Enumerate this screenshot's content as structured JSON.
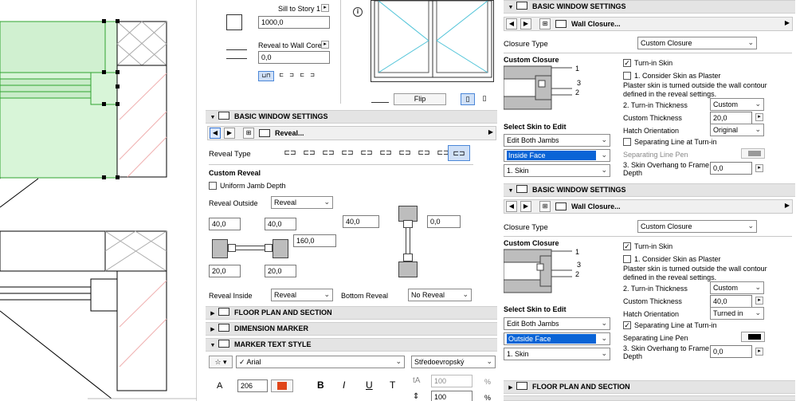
{
  "colors": {
    "accent": "#0a64d6",
    "plan_fill": "#d8f5d8",
    "plan_stroke": "#2fa32f",
    "hatch_red": "#f0b0b0",
    "swatch_red": "#e0461a"
  },
  "top_mid": {
    "sill_label": "Sill to Story 1",
    "sill_value": "1000,0",
    "reveal_core_label": "Reveal to Wall Core",
    "reveal_core_value": "0,0",
    "flip_label": "Flip"
  },
  "mid_panel": {
    "header1": "BASIC WINDOW SETTINGS",
    "nav_label": "Reveal...",
    "reveal_type_label": "Reveal Type",
    "custom_reveal_label": "Custom Reveal",
    "uniform_jamb_label": "Uniform Jamb Depth",
    "reveal_outside_label": "Reveal Outside",
    "reveal_outside_value": "Reveal",
    "d1_top_left": "40,0",
    "d1_top_right": "40,0",
    "d1_mid": "160,0",
    "d1_bot_left": "20,0",
    "d1_bot_right": "20,0",
    "d2_left": "40,0",
    "d2_right": "0,0",
    "reveal_inside_label": "Reveal Inside",
    "reveal_inside_value": "Reveal",
    "bottom_reveal_label": "Bottom Reveal",
    "bottom_reveal_value": "No Reveal",
    "header_floor": "FLOOR PLAN AND SECTION",
    "header_dim": "DIMENSION MARKER",
    "header_marker": "MARKER TEXT STYLE",
    "font_value": "Arial",
    "script_value": "Středoevropský",
    "font_size": "206",
    "width_pct": "100",
    "height_pct": "100",
    "pct_symbol": "%",
    "bold_glyph": "B",
    "italic_glyph": "I",
    "underline_glyph": "U",
    "strike_glyph": "T"
  },
  "right_top": {
    "header": "BASIC WINDOW SETTINGS",
    "nav_label": "Wall Closure...",
    "closure_type_label": "Closure Type",
    "closure_type_value": "Custom Closure",
    "custom_closure_label": "Custom Closure",
    "turn_in_skin_label": "Turn-in Skin",
    "consider_plaster_label": "1. Consider Skin as Plaster",
    "plaster_note": "Plaster skin is turned outside the wall contour defined in the reveal settings.",
    "turn_in_thickness_label": "2. Turn-in Thickness",
    "turn_in_thickness_value": "Custom",
    "custom_thickness_label": "Custom Thickness",
    "custom_thickness_value": "20,0",
    "hatch_orientation_label": "Hatch Orientation",
    "hatch_orientation_value": "Original",
    "separating_line_label": "Separating Line at Turn-in",
    "separating_pen_label": "Separating Line Pen",
    "select_skin_label": "Select Skin to Edit",
    "jambs_value": "Edit Both Jambs",
    "face_value": "Inside Face",
    "skin_value": "1. Skin",
    "overhang_label": "3. Skin Overhang to Frame Depth",
    "overhang_value": "0,0",
    "num1": "1",
    "num3": "3",
    "num2": "2"
  },
  "right_bottom": {
    "header": "BASIC WINDOW SETTINGS",
    "nav_label": "Wall Closure...",
    "closure_type_label": "Closure Type",
    "closure_type_value": "Custom Closure",
    "custom_closure_label": "Custom Closure",
    "turn_in_skin_label": "Turn-in Skin",
    "consider_plaster_label": "1. Consider Skin as Plaster",
    "plaster_note": "Plaster skin is turned outside the wall contour defined in the reveal settings.",
    "turn_in_thickness_label": "2. Turn-in Thickness",
    "turn_in_thickness_value": "Custom",
    "custom_thickness_label": "Custom Thickness",
    "custom_thickness_value": "40,0",
    "hatch_orientation_label": "Hatch Orientation",
    "hatch_orientation_value": "Turned in",
    "separating_line_label": "Separating Line at Turn-in",
    "separating_pen_label": "Separating Line Pen",
    "select_skin_label": "Select Skin to Edit",
    "jambs_value": "Edit Both Jambs",
    "face_value": "Outside Face",
    "skin_value": "1. Skin",
    "overhang_label": "3. Skin Overhang to Frame Depth",
    "overhang_value": "0,0",
    "num1": "1",
    "num3": "3",
    "num2": "2",
    "header_floor": "FLOOR PLAN AND SECTION"
  }
}
